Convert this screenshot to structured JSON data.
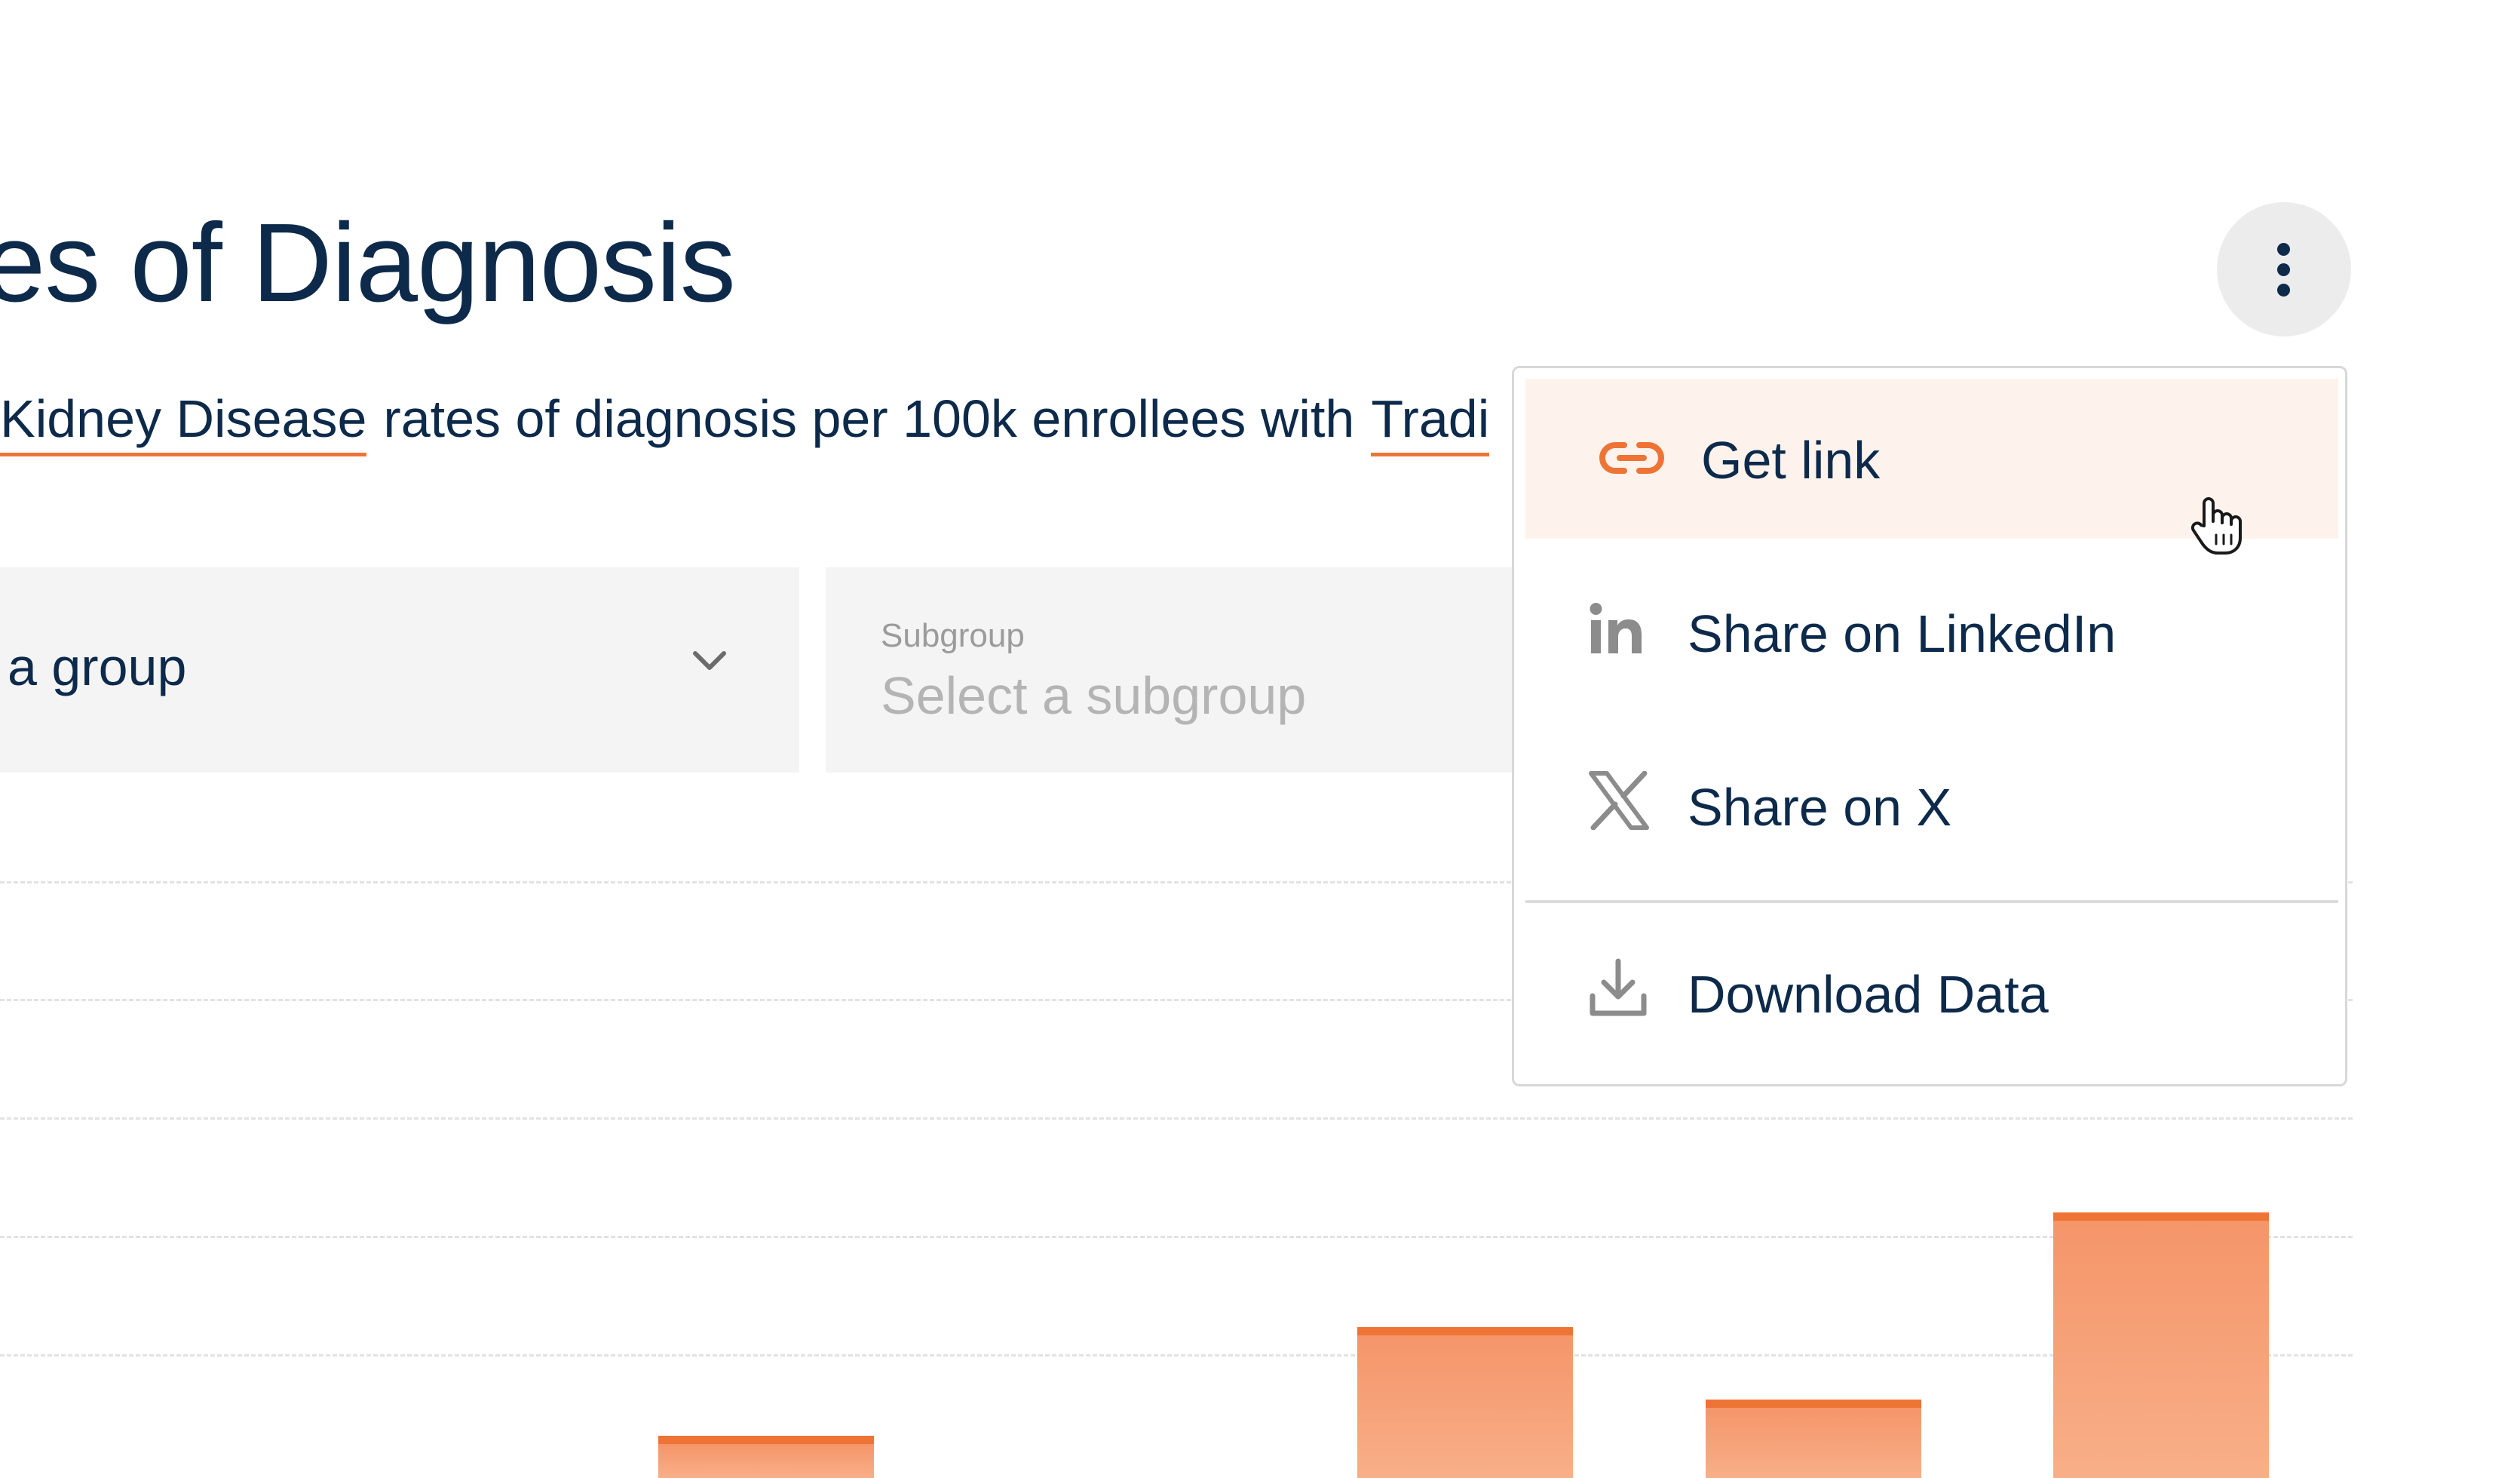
{
  "header": {
    "title": "es of Diagnosis"
  },
  "description": {
    "condition_link": "Kidney Disease",
    "middle_text": "rates of diagnosis per 100k enrollees with",
    "coverage_link": "Tradi"
  },
  "filters": {
    "group": {
      "value": "a group"
    },
    "subgroup": {
      "label": "Subgroup",
      "placeholder": "Select a subgroup"
    }
  },
  "chart_data": {
    "type": "bar",
    "note": "Chart partially obscured; axes and category labels not visible",
    "values_visible_fraction_of_gridspan": [
      0.07,
      0.25,
      0.13,
      0.44
    ],
    "colors": {
      "fill": "#f5956a",
      "edge": "#ee7436"
    }
  },
  "menu": {
    "items": [
      {
        "label": "Get link",
        "icon": "link-icon"
      },
      {
        "label": "Share on LinkedIn",
        "icon": "linkedin-icon"
      },
      {
        "label": "Share on X",
        "icon": "x-logo-icon"
      },
      {
        "label": "Download Data",
        "icon": "download-icon"
      }
    ]
  },
  "colors": {
    "accent": "#ee7436",
    "text": "#0d2a4b",
    "hover": "#fdf3ec"
  }
}
